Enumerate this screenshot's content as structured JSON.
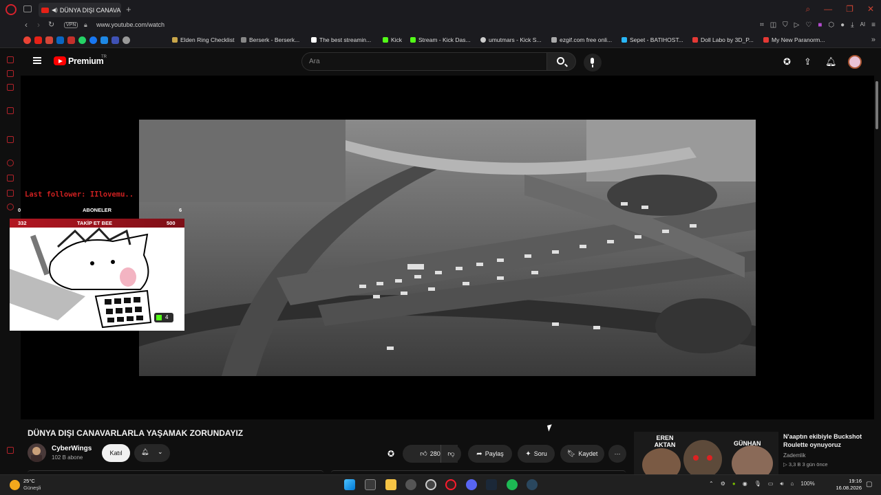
{
  "browser": {
    "tab_title": "DÜNYA DIŞI CANAVARL",
    "new_tab": "+",
    "url": "www.youtube.com/watch",
    "vpn_label": "VPN",
    "ai_label": "AI",
    "bookmarks": [
      "Elden Ring Checklist",
      "Berserk - Berserk...",
      "The best streamin...",
      "Kick",
      "Stream - Kick Das...",
      "umutmars - Kick S...",
      "ezgif.com free onli...",
      "Sepet - BATIHOST...",
      "Doll Labo by 3D_P...",
      "My New Paranorm..."
    ],
    "bookmark_more": "»"
  },
  "youtube": {
    "logo_text": "Premium",
    "country_code": "TR",
    "search_placeholder": "Ara"
  },
  "overlay": {
    "last_follower": "Last follower: IIlovemu..",
    "row1": {
      "left": "0",
      "label": "ABONELER",
      "right": "6"
    },
    "row2": {
      "left": "332",
      "label": "TAKİP ET BEE",
      "right": "500"
    },
    "badge": "4"
  },
  "video": {
    "title": "DÜNYA DIŞI CANAVARLARLA YAŞAMAK ZORUNDAYIZ",
    "channel_name": "CyberWings",
    "channel_subs": "102 B abone",
    "join_label": "Katıl",
    "like_count": "280",
    "share_label": "Paylaş",
    "ask_label": "Soru",
    "save_label": "Kaydet",
    "more_label": "···"
  },
  "recommended": {
    "title": "N'aaptın ekibiyle Buckshot Roulette oynuyoruz",
    "channel": "Zademlik",
    "meta": "3,3 B  3 gün önce",
    "thumb_left_text": "EREN AKTAN",
    "thumb_right_text": "GÜNHAN"
  },
  "taskbar": {
    "temperature": "25°C",
    "weather": "Güneşli",
    "battery": "100%",
    "time": "19:16",
    "date": "16.08.2026"
  }
}
